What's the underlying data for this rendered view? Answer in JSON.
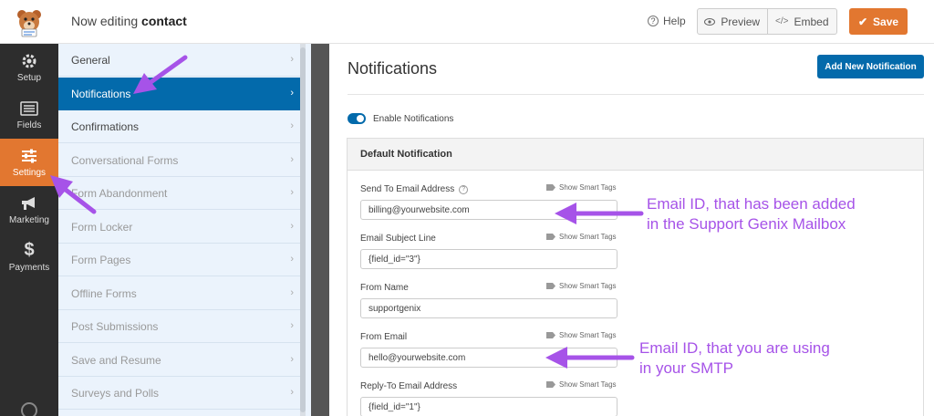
{
  "header": {
    "editing_prefix": "Now editing",
    "form_name": "contact",
    "help_label": "Help",
    "preview_label": "Preview",
    "embed_label": "Embed",
    "save_label": "Save"
  },
  "left_nav": [
    {
      "label": "Setup",
      "icon": "gear-icon"
    },
    {
      "label": "Fields",
      "icon": "list-icon"
    },
    {
      "label": "Settings",
      "icon": "sliders-icon",
      "active": true
    },
    {
      "label": "Marketing",
      "icon": "megaphone-icon"
    },
    {
      "label": "Payments",
      "icon": "dollar-icon"
    }
  ],
  "settings_menu": [
    {
      "label": "General"
    },
    {
      "label": "Notifications",
      "active": true
    },
    {
      "label": "Confirmations"
    },
    {
      "label": "Conversational Forms"
    },
    {
      "label": "Form Abandonment"
    },
    {
      "label": "Form Locker"
    },
    {
      "label": "Form Pages"
    },
    {
      "label": "Offline Forms"
    },
    {
      "label": "Post Submissions"
    },
    {
      "label": "Save and Resume"
    },
    {
      "label": "Surveys and Polls"
    }
  ],
  "main": {
    "title": "Notifications",
    "add_button": "Add New Notification",
    "enable_label": "Enable Notifications",
    "enabled": true,
    "card_title": "Default Notification",
    "smart_tags_label": "Show Smart Tags",
    "fields": [
      {
        "label": "Send To Email Address",
        "value": "billing@yourwebsite.com",
        "help": true
      },
      {
        "label": "Email Subject Line",
        "value": "{field_id=\"3\"}"
      },
      {
        "label": "From Name",
        "value": "supportgenix"
      },
      {
        "label": "From Email",
        "value": "hello@yourwebsite.com"
      },
      {
        "label": "Reply-To Email Address",
        "value": "{field_id=\"1\"}"
      }
    ]
  },
  "annotations": {
    "note1_line1": "Email ID, that has been added",
    "note1_line2": "in the Support Genix Mailbox",
    "note2_line1": "Email ID, that you are using",
    "note2_line2": "in your SMTP"
  },
  "colors": {
    "accent_orange": "#e27730",
    "primary_blue": "#036aab",
    "annotation_purple": "#a653e8"
  }
}
